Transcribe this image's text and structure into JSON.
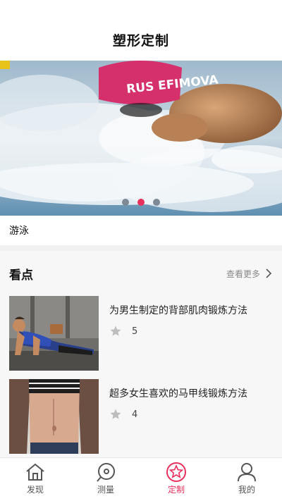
{
  "header": {
    "title": "塑形定制"
  },
  "banner": {
    "caption": "游泳",
    "cap_text": "RUS EFIMOVA",
    "slides": 3,
    "active_slide": 2
  },
  "section": {
    "title": "看点",
    "more_label": "查看更多"
  },
  "articles": [
    {
      "title": "为男生制定的背部肌肉锻炼方法",
      "likes": "5"
    },
    {
      "title": "超多女生喜欢的马甲线锻炼方法",
      "likes": "4"
    }
  ],
  "tabbar": {
    "items": [
      {
        "label": "发现",
        "icon": "home-icon"
      },
      {
        "label": "测量",
        "icon": "measure-icon"
      },
      {
        "label": "定制",
        "icon": "star-icon"
      },
      {
        "label": "我的",
        "icon": "user-icon"
      }
    ],
    "active_index": 2
  },
  "colors": {
    "accent": "#e8305c",
    "inactive": "#555555"
  }
}
